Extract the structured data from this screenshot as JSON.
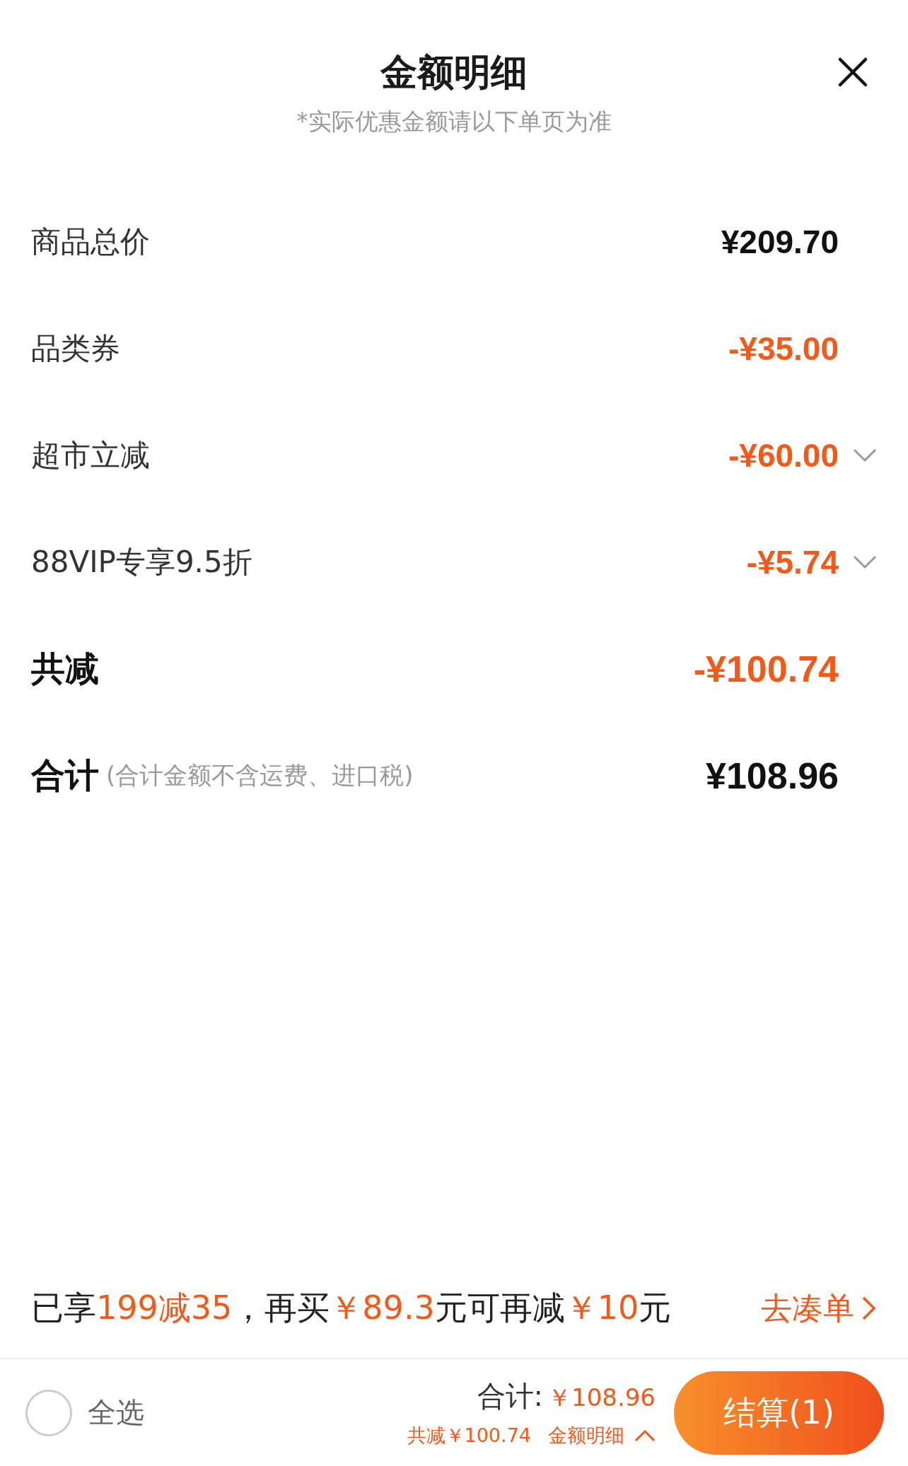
{
  "header": {
    "title": "金额明细",
    "subtitle": "*实际优惠金额请以下单页为准"
  },
  "rows": [
    {
      "kind": "plain",
      "label": "商品总价",
      "amount": "¥209.70",
      "expandable": false
    },
    {
      "kind": "discount",
      "label": "品类券",
      "amount": "-¥35.00",
      "expandable": false
    },
    {
      "kind": "discount",
      "label": "超市立减",
      "amount": "-¥60.00",
      "expandable": true
    },
    {
      "kind": "discount",
      "label": "88VIP专享9.5折",
      "amount": "-¥5.74",
      "expandable": true
    },
    {
      "kind": "saving",
      "label": "共减",
      "amount": "-¥100.74",
      "expandable": false
    },
    {
      "kind": "total",
      "label": "合计",
      "note": "(合计金额不含运费、进口税)",
      "amount": "¥108.96",
      "expandable": false
    }
  ],
  "promo": {
    "segments": [
      {
        "text": "已享",
        "highlight": false
      },
      {
        "text": "199减35",
        "highlight": true
      },
      {
        "text": "，再买",
        "highlight": false
      },
      {
        "text": "￥89.3",
        "highlight": true
      },
      {
        "text": "元可再减",
        "highlight": false
      },
      {
        "text": "￥10",
        "highlight": true
      },
      {
        "text": "元",
        "highlight": false
      }
    ],
    "link": "去凑单"
  },
  "bottom_bar": {
    "select_all": {
      "label": "全选",
      "checked": false
    },
    "total_label": "合计:",
    "total_amount": "￥108.96",
    "saved": "共减￥100.74",
    "details_link": "金额明细",
    "checkout_button": "结算(1)"
  }
}
